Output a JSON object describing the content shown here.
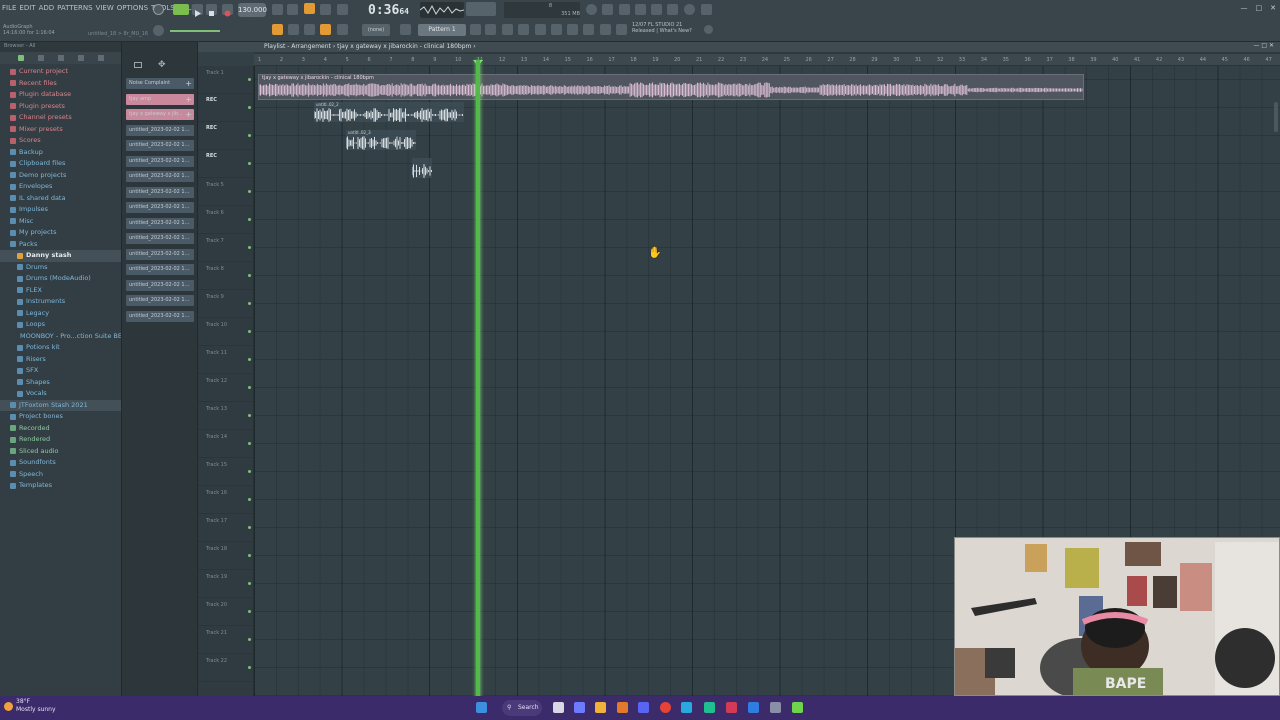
{
  "menu": [
    "FILE",
    "EDIT",
    "ADD",
    "PATTERNS",
    "VIEW",
    "OPTIONS",
    "TOOLS",
    "HELP"
  ],
  "hint": {
    "line1": "AudioGraph",
    "line2": "14:16:00 for 1:16:04",
    "project": "untitled_18 > 8r_MU_16"
  },
  "transport": {
    "tempo": "130.000",
    "time_main": "0:36",
    "time_sub": "64",
    "pattern": "Pattern 1",
    "mode": "(none)"
  },
  "cpu": {
    "line1": "8",
    "line2": "351 MB",
    "line3": "1"
  },
  "news": {
    "line1": "12/07 FL STUDIO 21",
    "line2": "Released | What's New?"
  },
  "browser": {
    "header": "Browser - All",
    "items": [
      {
        "label": "Current project",
        "color": "red",
        "level": 0
      },
      {
        "label": "Recent files",
        "color": "red",
        "level": 0
      },
      {
        "label": "Plugin database",
        "color": "red",
        "level": 0
      },
      {
        "label": "Plugin presets",
        "color": "red",
        "level": 0
      },
      {
        "label": "Channel presets",
        "color": "red",
        "level": 0
      },
      {
        "label": "Mixer presets",
        "color": "red",
        "level": 0
      },
      {
        "label": "Scores",
        "color": "red",
        "level": 0
      },
      {
        "label": "Backup",
        "color": "blue",
        "level": 0
      },
      {
        "label": "Clipboard files",
        "color": "blue",
        "level": 0
      },
      {
        "label": "Demo projects",
        "color": "blue",
        "level": 0
      },
      {
        "label": "Envelopes",
        "color": "blue",
        "level": 0
      },
      {
        "label": "IL shared data",
        "color": "blue",
        "level": 0
      },
      {
        "label": "Impulses",
        "color": "blue",
        "level": 0
      },
      {
        "label": "Misc",
        "color": "blue",
        "level": 0
      },
      {
        "label": "My projects",
        "color": "blue",
        "level": 0
      },
      {
        "label": "Packs",
        "color": "blue",
        "level": 0
      },
      {
        "label": "Danny stash",
        "color": "white",
        "level": 1,
        "selected": true
      },
      {
        "label": "Drums",
        "color": "blue",
        "level": 1
      },
      {
        "label": "Drums (ModeAudio)",
        "color": "blue",
        "level": 1
      },
      {
        "label": "FLEX",
        "color": "blue",
        "level": 1
      },
      {
        "label": "Instruments",
        "color": "blue",
        "level": 1
      },
      {
        "label": "Legacy",
        "color": "blue",
        "level": 1
      },
      {
        "label": "Loops",
        "color": "blue",
        "level": 1
      },
      {
        "label": "MOONBOY - Pro...ction Suite BETA",
        "color": "blue",
        "level": 1
      },
      {
        "label": "Potions kit",
        "color": "blue",
        "level": 1
      },
      {
        "label": "Risers",
        "color": "blue",
        "level": 1
      },
      {
        "label": "SFX",
        "color": "blue",
        "level": 1
      },
      {
        "label": "Shapes",
        "color": "blue",
        "level": 1
      },
      {
        "label": "Vocals",
        "color": "blue",
        "level": 1
      },
      {
        "label": "JTFoxtom Stash 2021",
        "color": "blue",
        "level": 0,
        "selected": true
      },
      {
        "label": "Project bones",
        "color": "blue",
        "level": 0
      },
      {
        "label": "Recorded",
        "color": "green",
        "level": 0
      },
      {
        "label": "Rendered",
        "color": "green",
        "level": 0
      },
      {
        "label": "Sliced audio",
        "color": "green",
        "level": 0
      },
      {
        "label": "Soundfonts",
        "color": "blue",
        "level": 0
      },
      {
        "label": "Speech",
        "color": "blue",
        "level": 0
      },
      {
        "label": "Templates",
        "color": "blue",
        "level": 0
      }
    ]
  },
  "patterns": [
    {
      "label": "Noise Complaint",
      "color": "#4a5a66"
    },
    {
      "label": "tjay amp",
      "color": "#c9889c"
    },
    {
      "label": "tjay x gateway x jib...",
      "color": "#c9889c"
    },
    {
      "label": "untitled_2023-02-02 1...",
      "color": "#4a5a66"
    },
    {
      "label": "untitled_2023-02-02 1...",
      "color": "#4a5a66"
    },
    {
      "label": "untitled_2023-02-02 1...",
      "color": "#4a5a66"
    },
    {
      "label": "untitled_2023-02-02 1...",
      "color": "#4a5a66"
    },
    {
      "label": "untitled_2023-02-02 1...",
      "color": "#4a5a66"
    },
    {
      "label": "untitled_2023-02-02 1...",
      "color": "#4a5a66"
    },
    {
      "label": "untitled_2023-02-02 1...",
      "color": "#4a5a66"
    },
    {
      "label": "untitled_2023-02-02 1...",
      "color": "#4a5a66"
    },
    {
      "label": "untitled_2023-02-02 1...",
      "color": "#4a5a66"
    },
    {
      "label": "untitled_2023-02-02 1...",
      "color": "#4a5a66"
    },
    {
      "label": "untitled_2023-02-02 1...",
      "color": "#4a5a66"
    },
    {
      "label": "untitled_2023-02-02 1...",
      "color": "#4a5a66"
    },
    {
      "label": "untitled_2023-02-02 1...",
      "color": "#4a5a66"
    }
  ],
  "playlist": {
    "title": "Playlist - Arrangement › tjay x gateway x jibarockin - clinical 180bpm ›",
    "audio_clip_label": "tjay x gateway x jibarockin - clinical 180bpm",
    "clip_labels": [
      "untitl..02_2",
      "untitl..02_3"
    ],
    "tracks": [
      "Track 1",
      "REC",
      "REC",
      "REC",
      "Track 5",
      "Track 6",
      "Track 7",
      "Track 8",
      "Track 9",
      "Track 10",
      "Track 11",
      "Track 12",
      "Track 13",
      "Track 14",
      "Track 15",
      "Track 16",
      "Track 17",
      "Track 18",
      "Track 19",
      "Track 20",
      "Track 21",
      "Track 22"
    ],
    "ruler_ticks": [
      "1",
      "2",
      "3",
      "4",
      "5",
      "6",
      "7",
      "8",
      "9",
      "10",
      "11",
      "12",
      "13",
      "14",
      "15",
      "16",
      "17",
      "18",
      "19",
      "20",
      "21",
      "22",
      "23",
      "24",
      "25",
      "26",
      "27",
      "28",
      "29",
      "30",
      "31",
      "32",
      "33",
      "34",
      "35",
      "36",
      "37",
      "38",
      "39",
      "40",
      "41",
      "42",
      "43",
      "44",
      "45",
      "46",
      "47"
    ]
  },
  "taskbar": {
    "weather_temp": "38°F",
    "weather_desc": "Mostly sunny",
    "search": "Search"
  },
  "colors": {
    "playhead": "#53b94a",
    "audio_wave": "#dcbfd4",
    "taskbar": "#3c2b6b"
  }
}
